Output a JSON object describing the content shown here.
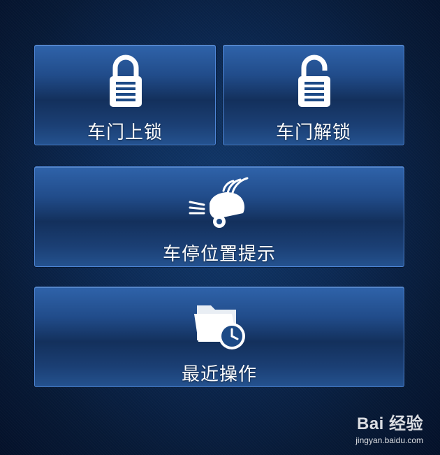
{
  "buttons": {
    "lock": {
      "label": "车门上锁",
      "icon": "lock-icon"
    },
    "unlock": {
      "label": "车门解锁",
      "icon": "unlock-icon"
    },
    "park": {
      "label": "车停位置提示",
      "icon": "car-locate-icon"
    },
    "recent": {
      "label": "最近操作",
      "icon": "folder-clock-icon"
    }
  },
  "watermark": {
    "brand": "Bai  经验",
    "url": "jingyan.baidu.com"
  },
  "colors": {
    "background": "#0c2a55",
    "tile_border": "#4f86d6",
    "tile_top": "#2f63aa",
    "tile_mid": "#13305c",
    "label": "#ffffff"
  }
}
